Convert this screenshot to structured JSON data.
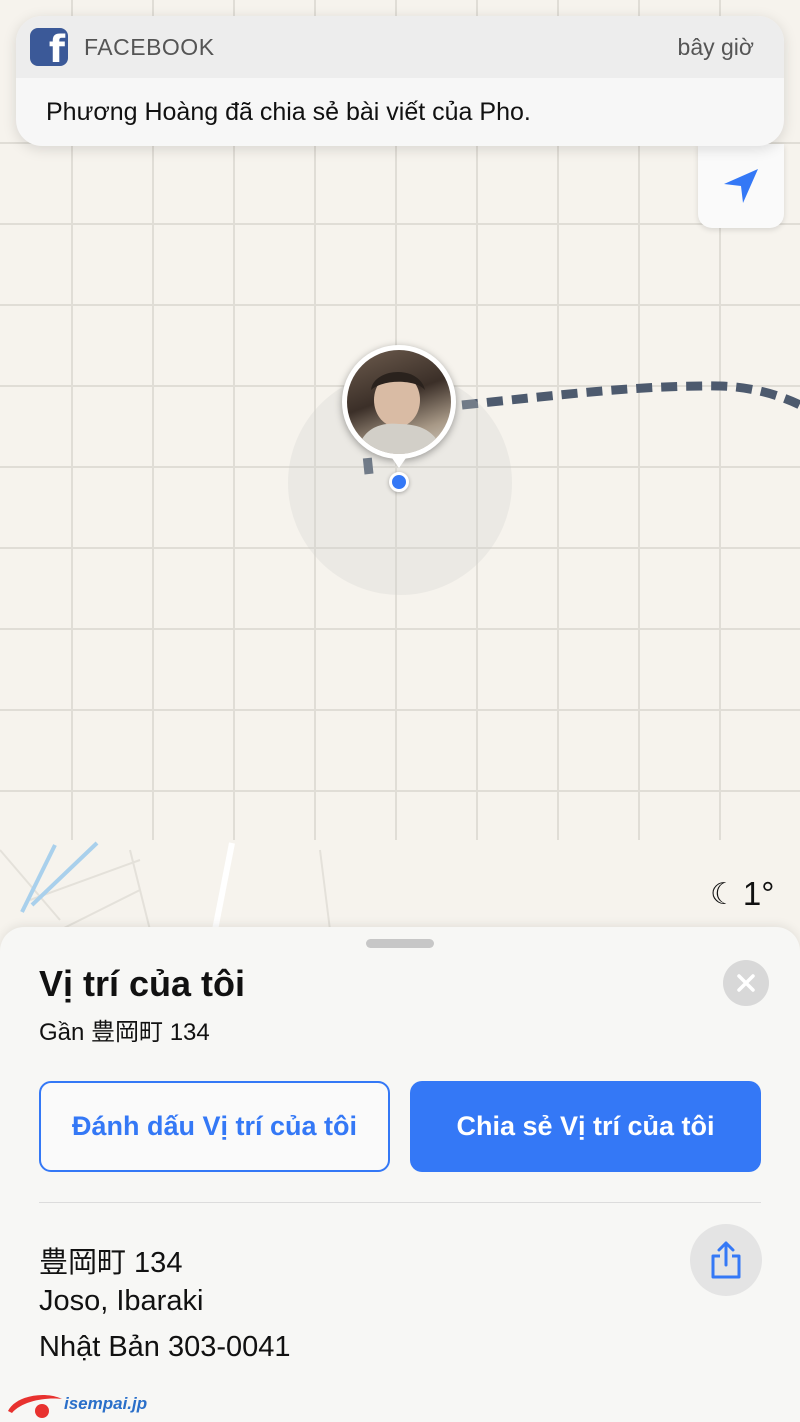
{
  "notification": {
    "app_name": "FACEBOOK",
    "time": "bây giờ",
    "message": "Phương Hoàng đã chia sẻ bài viết của Pho.",
    "icon": "facebook-icon"
  },
  "map": {
    "locate_icon": "location-arrow-icon",
    "weather_icon": "moon-stars-icon",
    "temperature": "1°",
    "accent_color": "#3478f6"
  },
  "sheet": {
    "title": "Vị trí của tôi",
    "subtitle": "Gần 豊岡町 134",
    "mark_button": "Đánh dấu Vị trí của tôi",
    "share_location_button": "Chia sẻ Vị trí của tôi",
    "address": {
      "line1": "豊岡町 134",
      "line2": "Joso, Ibaraki",
      "line3": "Nhật Bản 303-0041"
    },
    "close_icon": "close-icon",
    "share_icon": "share-icon"
  },
  "watermark": {
    "text": "isempai.jp"
  }
}
